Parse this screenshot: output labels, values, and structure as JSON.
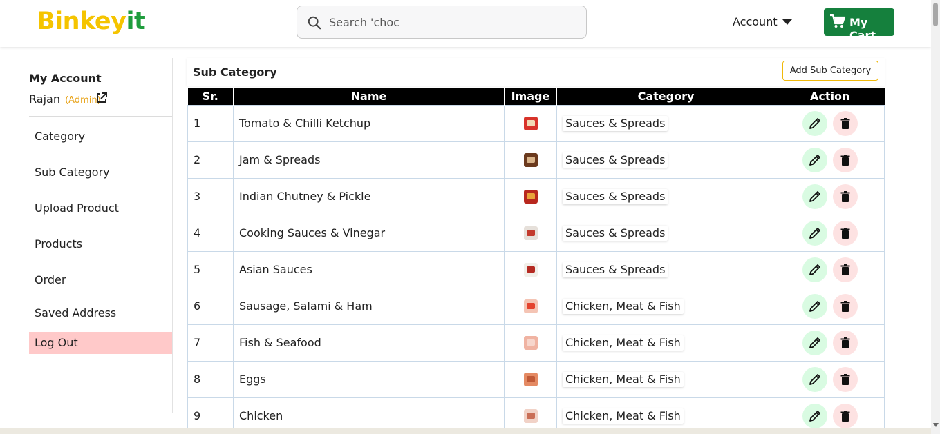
{
  "header": {
    "logo_part1": "Binkey",
    "logo_part2": "it",
    "search_placeholder": "Search 'choc",
    "account_label": "Account",
    "cart_label": "My Cart"
  },
  "sidebar": {
    "title": "My Account",
    "user_name": "Rajan",
    "role": "(Admin)",
    "items": [
      {
        "label": "Category"
      },
      {
        "label": "Sub Category"
      },
      {
        "label": "Upload Product"
      },
      {
        "label": "Products"
      },
      {
        "label": "Order"
      },
      {
        "label": "Saved Address"
      },
      {
        "label": "Log Out"
      }
    ]
  },
  "panel": {
    "title": "Sub Category",
    "add_button": "Add Sub Category"
  },
  "table": {
    "headers": [
      "Sr.",
      "Name",
      "Image",
      "Category",
      "Action"
    ],
    "rows": [
      {
        "sr": "1",
        "name": "Tomato & Chilli Ketchup",
        "category": "Sauces & Spreads"
      },
      {
        "sr": "2",
        "name": "Jam & Spreads",
        "category": "Sauces & Spreads"
      },
      {
        "sr": "3",
        "name": "Indian Chutney & Pickle",
        "category": "Sauces & Spreads"
      },
      {
        "sr": "4",
        "name": "Cooking Sauces & Vinegar",
        "category": "Sauces & Spreads"
      },
      {
        "sr": "5",
        "name": "Asian Sauces",
        "category": "Sauces & Spreads"
      },
      {
        "sr": "6",
        "name": "Sausage, Salami & Ham",
        "category": "Chicken, Meat & Fish"
      },
      {
        "sr": "7",
        "name": "Fish & Seafood",
        "category": "Chicken, Meat & Fish"
      },
      {
        "sr": "8",
        "name": "Eggs",
        "category": "Chicken, Meat & Fish"
      },
      {
        "sr": "9",
        "name": "Chicken",
        "category": "Chicken, Meat & Fish"
      }
    ]
  },
  "colors": {
    "logo_yellow": "#f5c400",
    "logo_green": "#1f9d3d",
    "cart_green": "#15803d",
    "admin_orange": "#e8a319",
    "logout_bg": "#ffc9c9",
    "edit_bg": "#d9fbe2",
    "delete_bg": "#fde2e2"
  },
  "icons": {
    "search": "search-icon",
    "caret": "caret-down-icon",
    "cart": "cart-icon",
    "external": "external-link-icon",
    "edit": "pencil-icon",
    "delete": "trash-icon"
  }
}
